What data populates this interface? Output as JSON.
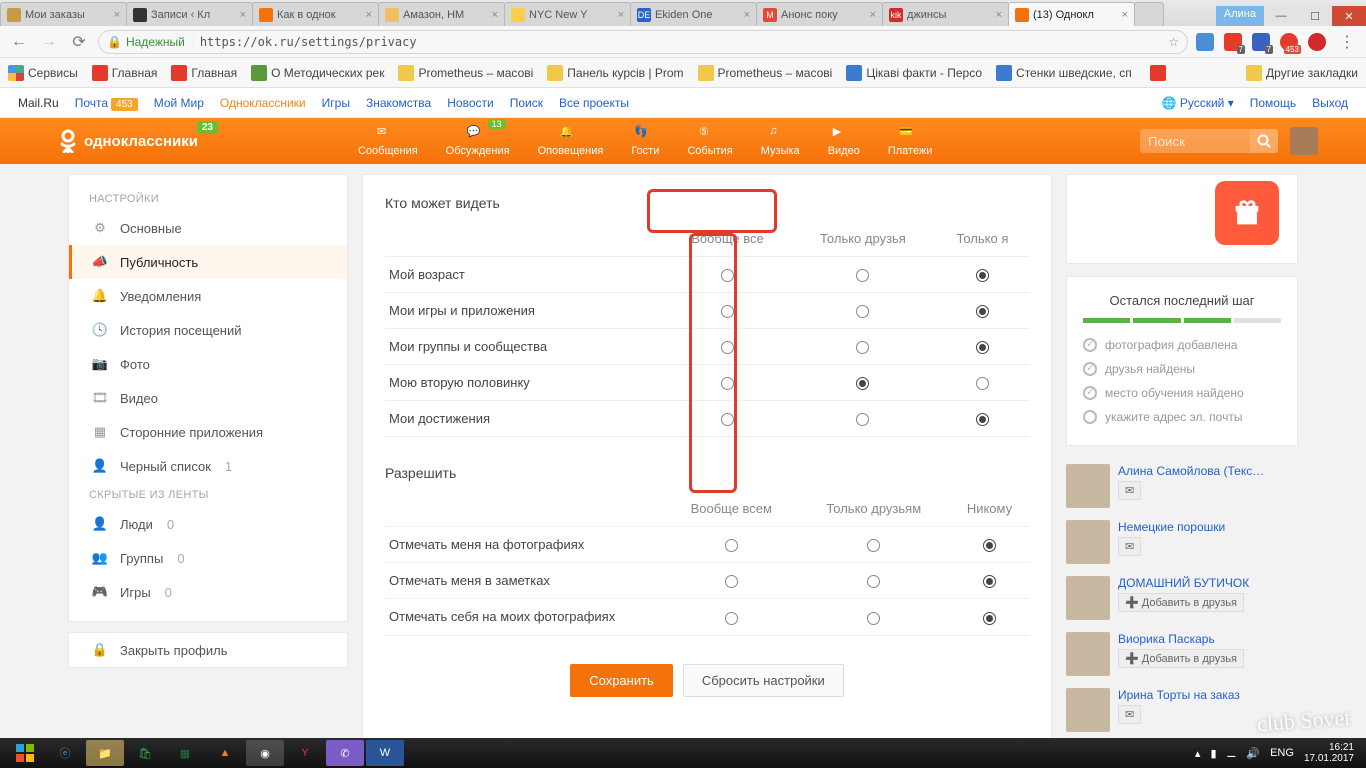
{
  "browser": {
    "user": "Алина",
    "tabs": [
      {
        "title": "Мои заказы",
        "fav": "#c79a4a"
      },
      {
        "title": "Записи ‹ Кл",
        "fav": "#333"
      },
      {
        "title": "Как в однок",
        "fav": "#f5720a"
      },
      {
        "title": "Амазон, НМ",
        "fav": "#f0c060"
      },
      {
        "title": "NYC New Y",
        "fav": "#f7cf4a"
      },
      {
        "title": "Ekiden One",
        "fav": "#2a62c9",
        "favtxt": "DE"
      },
      {
        "title": "Анонс поку",
        "fav": "#e04a3a",
        "favtxt": "M"
      },
      {
        "title": "джинсы",
        "fav": "#d02a2a",
        "favtxt": "kik"
      },
      {
        "title": "(13) Однокл",
        "fav": "#f5720a",
        "active": true
      }
    ],
    "secure_label": "Надежный",
    "url": "https://ok.ru/settings/privacy",
    "ext_badge": "7",
    "bookmarks": {
      "services": "Сервисы",
      "items": [
        {
          "label": "Главная",
          "color": "#e43a2a"
        },
        {
          "label": "Главная",
          "color": "#e43a2a"
        },
        {
          "label": "О Методических рек",
          "color": "#5a9a3a"
        },
        {
          "label": "Prometheus – масові",
          "color": "#f2c84b"
        },
        {
          "label": "Панель курсів | Prom",
          "color": "#f2c84b"
        },
        {
          "label": "Prometheus – масові",
          "color": "#f2c84b"
        },
        {
          "label": "Цікаві факти - Персо",
          "color": "#3a7dd0"
        },
        {
          "label": "Стенки шведские, сп",
          "color": "#3a7dd0"
        }
      ],
      "other": "Другие закладки"
    }
  },
  "mailru": {
    "items": [
      "Mail.Ru",
      "Почта",
      "Мой Мир",
      "Одноклассники",
      "Игры",
      "Знакомства",
      "Новости",
      "Поиск",
      "Все проекты"
    ],
    "mailcount": "453",
    "lang": "Русский",
    "help": "Помощь",
    "exit": "Выход"
  },
  "ok": {
    "logo": "одноклассники",
    "logo_badge": "23",
    "nav": [
      {
        "label": "Сообщения"
      },
      {
        "label": "Обсуждения",
        "badge": "13"
      },
      {
        "label": "Оповещения"
      },
      {
        "label": "Гости"
      },
      {
        "label": "События"
      },
      {
        "label": "Музыка"
      },
      {
        "label": "Видео"
      },
      {
        "label": "Платежи"
      }
    ],
    "search_placeholder": "Поиск"
  },
  "settings": {
    "heading": "НАСТРОЙКИ",
    "items": [
      {
        "label": "Основные"
      },
      {
        "label": "Публичность",
        "selected": true
      },
      {
        "label": "Уведомления"
      },
      {
        "label": "История посещений"
      },
      {
        "label": "Фото"
      },
      {
        "label": "Видео"
      },
      {
        "label": "Сторонние приложения"
      },
      {
        "label": "Черный список",
        "count": "1"
      }
    ],
    "hidden_heading": "СКРЫТЫЕ ИЗ ЛЕНТЫ",
    "hidden": [
      {
        "label": "Люди",
        "count": "0"
      },
      {
        "label": "Группы",
        "count": "0"
      },
      {
        "label": "Игры",
        "count": "0"
      }
    ],
    "close": "Закрыть профиль"
  },
  "privacy": {
    "who_heading": "Кто может видеть",
    "cols_who": [
      "Вообще все",
      "Только друзья",
      "Только я"
    ],
    "rows_who": [
      {
        "label": "Мой возраст",
        "sel": 2
      },
      {
        "label": "Мои игры и приложения",
        "sel": 2
      },
      {
        "label": "Мои группы и сообщества",
        "sel": 2
      },
      {
        "label": "Мою вторую половинку",
        "sel": 1
      },
      {
        "label": "Мои достижения",
        "sel": 2
      }
    ],
    "allow_heading": "Разрешить",
    "cols_allow": [
      "Вообще всем",
      "Только друзьям",
      "Никому"
    ],
    "rows_allow": [
      {
        "label": "Отмечать меня на фотографиях",
        "sel": 2
      },
      {
        "label": "Отмечать меня в заметках",
        "sel": 2
      },
      {
        "label": "Отмечать себя на моих фотографиях",
        "sel": 2
      }
    ],
    "save": "Сохранить",
    "reset": "Сбросить настройки"
  },
  "rightcol": {
    "last_step": "Остался последний шаг",
    "checks": [
      {
        "label": "фотография добавлена",
        "done": true
      },
      {
        "label": "друзья найдены",
        "done": true
      },
      {
        "label": "место обучения найдено",
        "done": true
      },
      {
        "label": "укажите адрес эл. почты",
        "done": false
      }
    ],
    "friends": [
      {
        "name": "Алина Самойлова (Текс…",
        "action": "mail"
      },
      {
        "name": "Немецкие порошки",
        "action": "mail"
      },
      {
        "name": "ДОМАШНИЙ БУТИЧОК",
        "action": "add",
        "btn": "Добавить в друзья"
      },
      {
        "name": "Виорика Паскарь",
        "action": "add",
        "btn": "Добавить в друзья"
      },
      {
        "name": "Ирина Торты на заказ",
        "action": "mail"
      }
    ]
  },
  "taskbar": {
    "lang": "ENG",
    "time": "16:21",
    "date": "17.01.2017"
  },
  "watermark": "club Sovet"
}
